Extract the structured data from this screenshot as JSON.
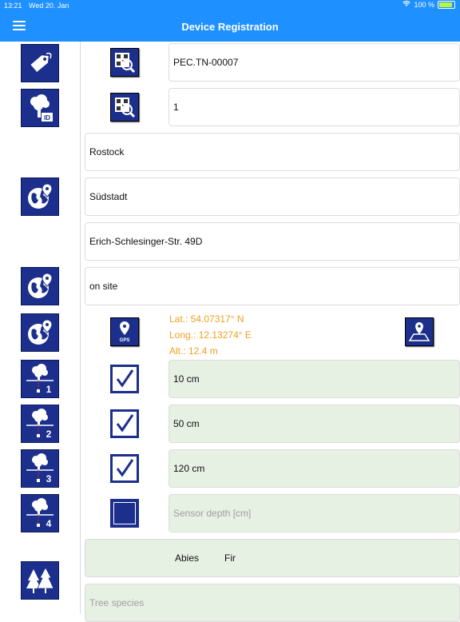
{
  "status_bar": {
    "time": "13:21",
    "date": "Wed 20. Jan",
    "battery": "100 %"
  },
  "header": {
    "title": "Device Registration"
  },
  "device": {
    "serial": "PEC.TN-00007",
    "tree_id": "1",
    "city": "Rostock",
    "district": "Südstadt",
    "street": "Erich-Schlesinger-Str. 49D",
    "location_mode": "on site"
  },
  "gps": {
    "button_label": "GPS",
    "lat": "Lat.: 54.07317° N",
    "long": "Long.: 12.13274° E",
    "alt": "Alt.: 12.4 m"
  },
  "sensors": [
    {
      "number": "1",
      "depth": "10 cm",
      "checked": true
    },
    {
      "number": "2",
      "depth": "50 cm",
      "checked": true
    },
    {
      "number": "3",
      "depth": "120 cm",
      "checked": true
    },
    {
      "number": "4",
      "depth": "",
      "placeholder": "Sensor depth [cm]",
      "checked": false
    }
  ],
  "species": {
    "latin": "Abies",
    "common": "Fir",
    "placeholder": "Tree species"
  },
  "icons": {
    "tag": "tag-icon",
    "tree_id": "tree-id-icon",
    "globe": "globe-location-icon",
    "qr": "qr-scan-icon",
    "map": "map-pin-icon",
    "forest": "forest-icon"
  },
  "colors": {
    "accent": "#1e90ff",
    "icon_bg": "#1c2f8c",
    "gps_text": "#f0a020",
    "field_green": "#e6f0e3"
  }
}
